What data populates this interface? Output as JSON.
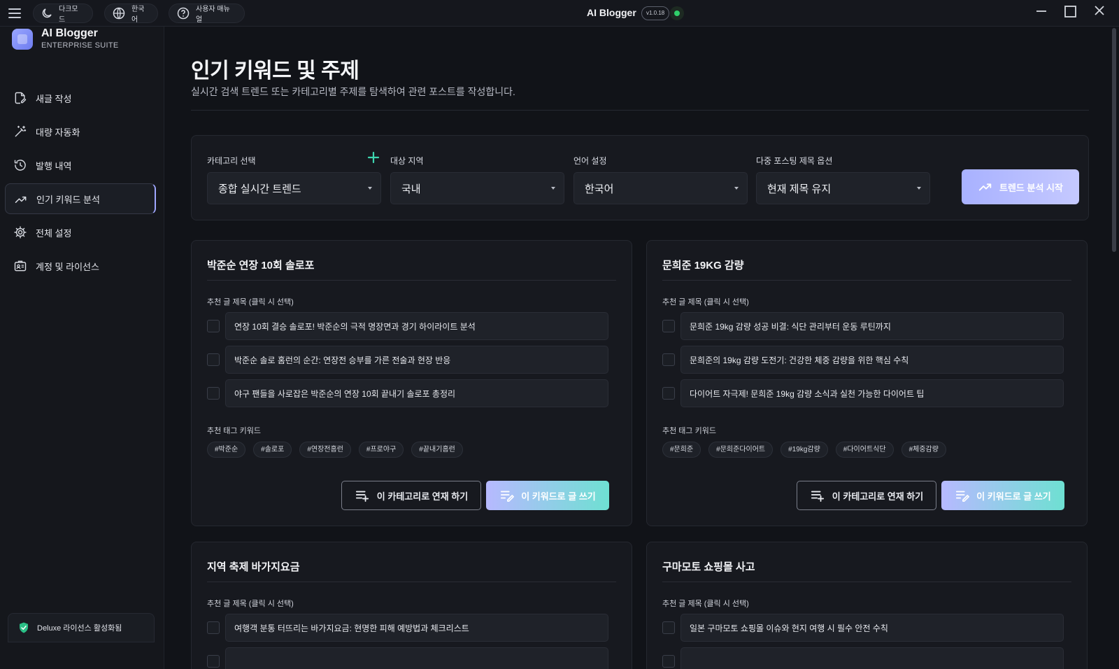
{
  "titlebar": {
    "dark_mode_label": "다크모드",
    "language_label": "한국어",
    "manual_label": "사용자 매뉴얼",
    "app_title": "AI Blogger",
    "version": "v1.0.18"
  },
  "sidebar": {
    "brand_name": "AI Blogger",
    "brand_sub": "ENTERPRISE SUITE",
    "items": [
      {
        "label": "새글 작성",
        "icon": "new-post-icon"
      },
      {
        "label": "대량 자동화",
        "icon": "magic-wand-icon"
      },
      {
        "label": "발행 내역",
        "icon": "history-icon"
      },
      {
        "label": "인기 키워드 분석",
        "icon": "trending-icon",
        "active": true
      },
      {
        "label": "전체 설정",
        "icon": "gear-icon"
      },
      {
        "label": "계정 및 라이선스",
        "icon": "license-icon"
      }
    ],
    "license_text": "Deluxe 라이선스 활성화됨"
  },
  "main": {
    "title": "인기 키워드 및 주제",
    "subtitle": "실시간 검색 트렌드 또는 카테고리별 주제를 탐색하여 관련 포스트를 작성합니다.",
    "filters": {
      "category_label": "카테고리 선택",
      "category_value": "종합 실시간 트렌드",
      "region_label": "대상 지역",
      "region_value": "국내",
      "language_label": "언어 설정",
      "language_value": "한국어",
      "title_option_label": "다중 포스팅 제목 옵션",
      "title_option_value": "현재 제목 유지",
      "analyze_button": "트렌드 분석 시작"
    },
    "labels": {
      "suggested_titles": "추천 글 제목 (클릭 시 선택)",
      "suggested_tags": "추천 태그 키워드",
      "series_button": "이 카테고리로 연재 하기",
      "write_button": "이 키워드로 글 쓰기"
    },
    "cards": [
      {
        "title": "박준순 연장 10회 솔로포",
        "titles": [
          "연장 10회 결승 솔로포! 박준순의 극적 명장면과 경기 하이라이트 분석",
          "박준순 솔로 홈런의 순간: 연장전 승부를 가른 전술과 현장 반응",
          "야구 팬들을 사로잡은 박준순의 연장 10회 끝내기 솔로포 총정리"
        ],
        "tags": [
          "#박준순",
          "#솔로포",
          "#연장전홈런",
          "#프로야구",
          "#끝내기홈런"
        ]
      },
      {
        "title": "문희준 19KG 감량",
        "titles": [
          "문희준 19kg 감량 성공 비결: 식단 관리부터 운동 루틴까지",
          "문희준의 19kg 감량 도전기: 건강한 체중 감량을 위한 핵심 수칙",
          "다이어트 자극제! 문희준 19kg 감량 소식과 실천 가능한 다이어트 팁"
        ],
        "tags": [
          "#문희준",
          "#문희준다이어트",
          "#19kg감량",
          "#다이어트식단",
          "#체중감량"
        ]
      },
      {
        "title": "지역 축제 바가지요금",
        "titles": [
          "여행객 분통 터뜨리는 바가지요금: 현명한 피해 예방법과 체크리스트"
        ]
      },
      {
        "title": "구마모토 쇼핑몰 사고",
        "titles": [
          "일본 구마모토 쇼핑몰 이슈와 현지 여행 시 필수 안전 수칙"
        ]
      }
    ]
  },
  "colors": {
    "accent": "#a8b1ff",
    "accent_teal": "#6ee0d2",
    "online": "#2fd06a",
    "background": "#111318"
  }
}
